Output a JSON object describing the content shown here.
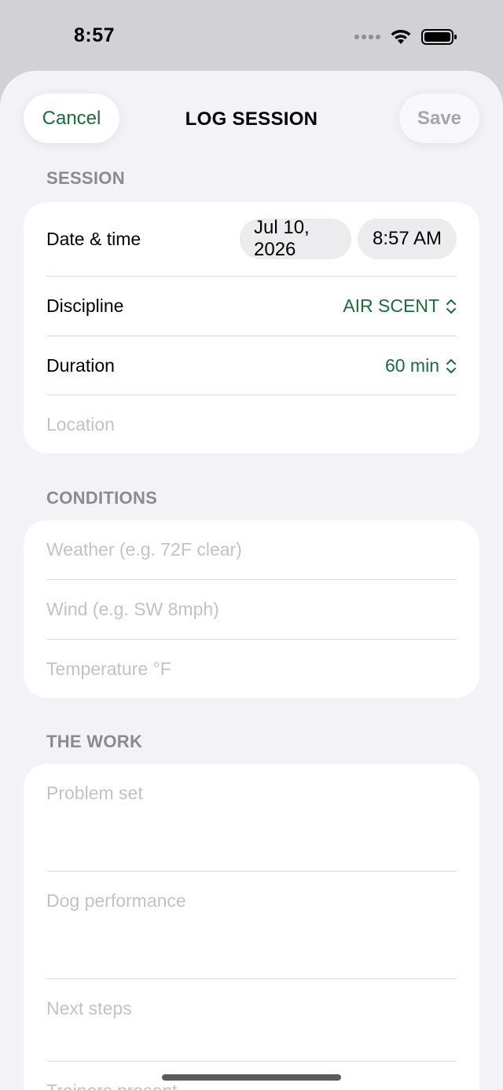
{
  "status_bar": {
    "time": "8:57"
  },
  "nav": {
    "cancel_label": "Cancel",
    "title": "LOG SESSION",
    "save_label": "Save"
  },
  "session": {
    "header": "SESSION",
    "date_time_label": "Date & time",
    "date_value": "Jul 10, 2026",
    "time_value": "8:57 AM",
    "discipline_label": "Discipline",
    "discipline_value": "AIR SCENT",
    "duration_label": "Duration",
    "duration_value": "60 min",
    "location_placeholder": "Location"
  },
  "conditions": {
    "header": "CONDITIONS",
    "weather_placeholder": "Weather (e.g. 72F clear)",
    "wind_placeholder": "Wind (e.g. SW 8mph)",
    "temperature_placeholder": "Temperature °F"
  },
  "work": {
    "header": "THE WORK",
    "problem_set_placeholder": "Problem set",
    "dog_performance_placeholder": "Dog performance",
    "next_steps_placeholder": "Next steps",
    "trainers_present_placeholder": "Trainers present"
  },
  "colors": {
    "accent": "#1c6b3a",
    "background": "#f2f2f7",
    "placeholder": "#c2c2c6"
  },
  "icons": [
    "wifi-icon",
    "battery-icon",
    "signal-dots-icon",
    "chevron-updown-icon"
  ]
}
